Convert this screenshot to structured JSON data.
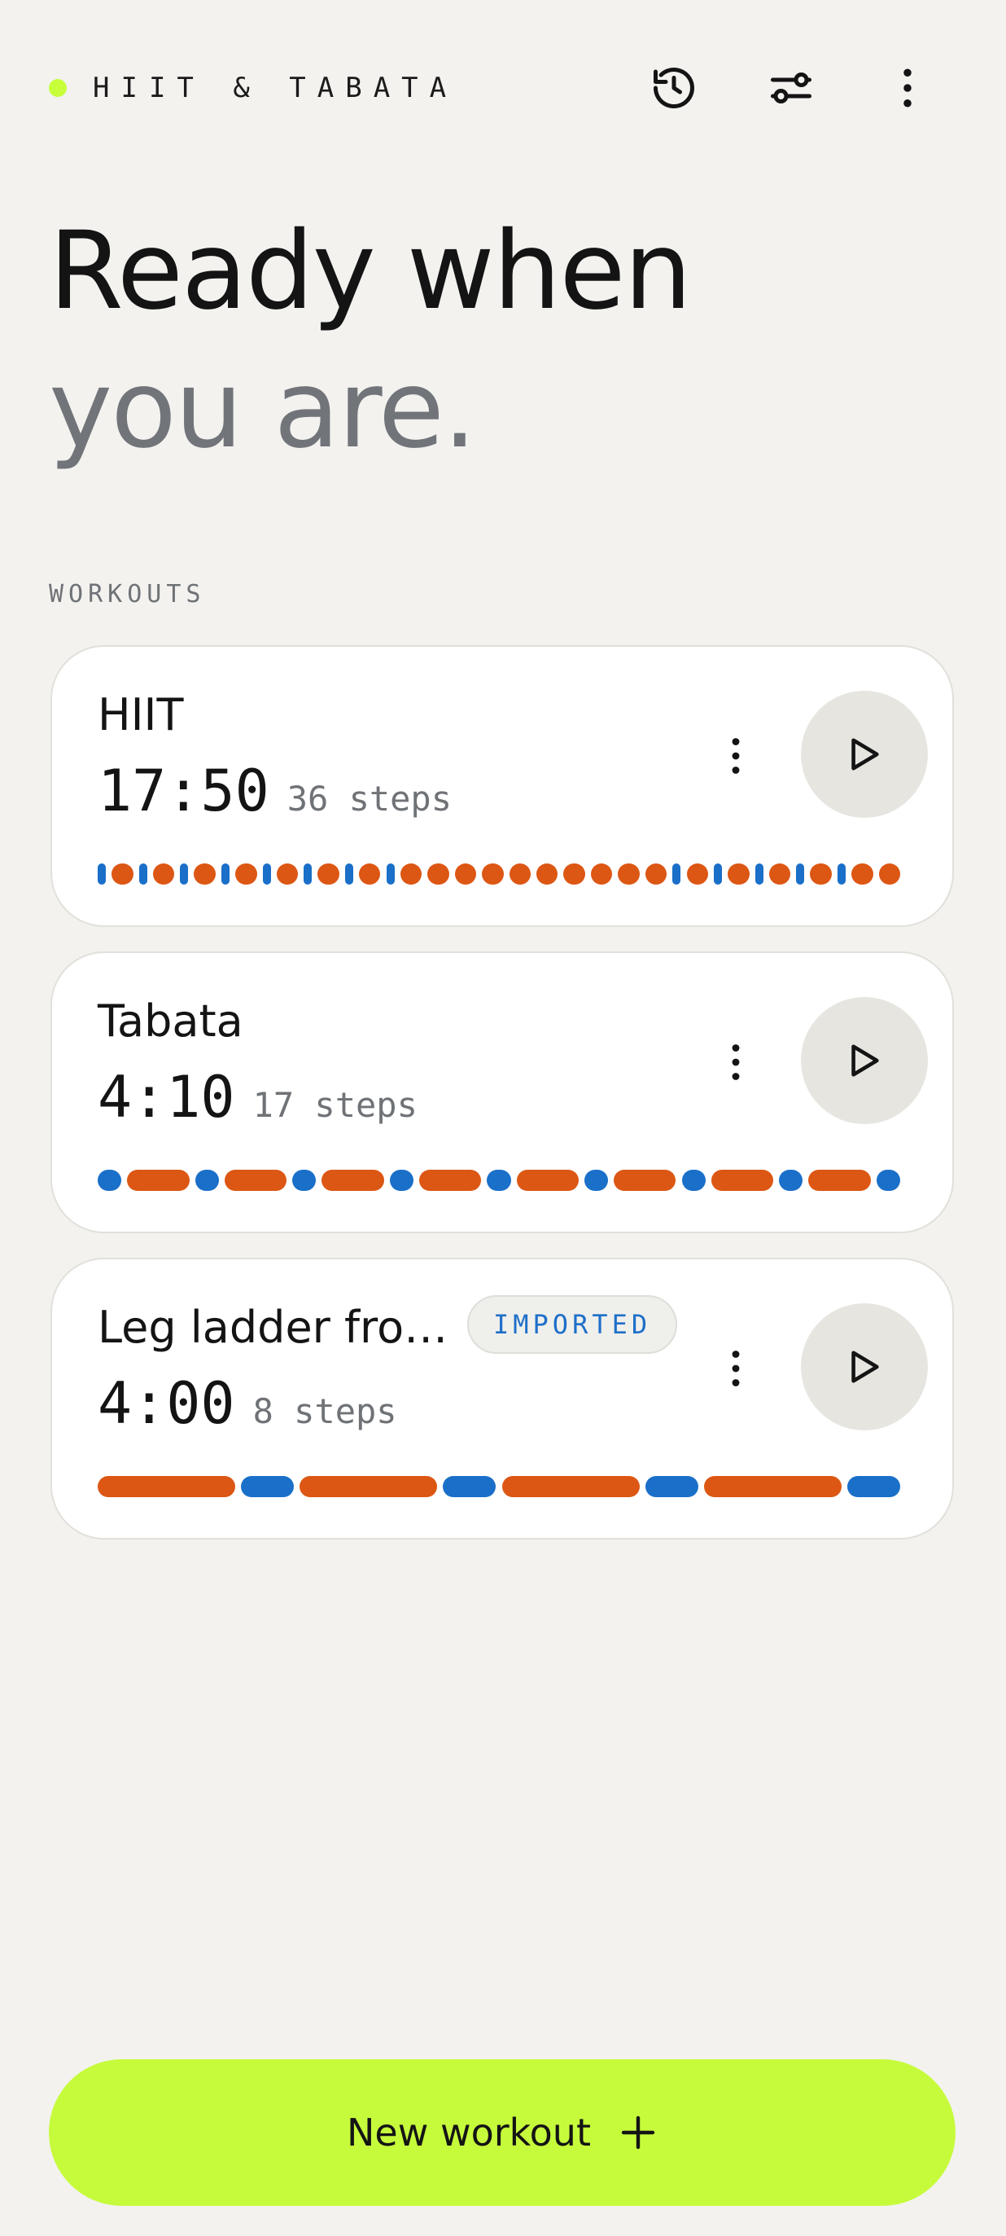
{
  "header": {
    "app_title": "HIIT & TABATA",
    "dot_color": "#c6ff3a",
    "icons": [
      "history-icon",
      "sliders-icon",
      "more-vertical-icon"
    ]
  },
  "hero": {
    "line1": "Ready when",
    "line2": "you are."
  },
  "section": {
    "label": "WORKOUTS"
  },
  "colors": {
    "work": "#dc5714",
    "rest": "#1a6fc9",
    "accent": "#c6fb3c"
  },
  "workouts": [
    {
      "title": "HIIT",
      "duration": "17:50",
      "steps": "36 steps",
      "badge": "",
      "segments": "RWRWRWRWRWRWRWRWWWWWWWWWWRWRWRWRWRWW"
    },
    {
      "title": "Tabata",
      "duration": "4:10",
      "steps": "17 steps",
      "badge": "",
      "segments": "RWRWRWRWRWRWRWRWR"
    },
    {
      "title": "Leg ladder fro…",
      "duration": "4:00",
      "steps": "8 steps",
      "badge": "IMPORTED",
      "segments": "WRWRWRWR"
    }
  ],
  "cta": {
    "label": "New workout"
  }
}
